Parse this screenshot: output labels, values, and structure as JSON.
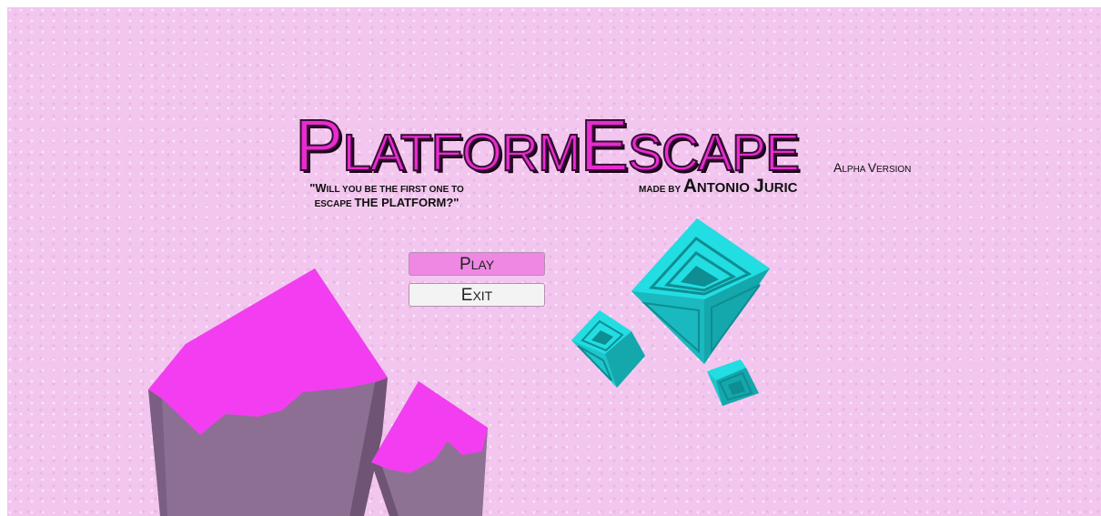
{
  "game": {
    "title_first": "P",
    "title_rest1": "LATFORM",
    "title_mid": "E",
    "title_rest2": "SCAPE",
    "version_first": "A",
    "version_rest1": "LPHA ",
    "version_v": "V",
    "version_rest2": "ERSION",
    "tagline_line1_big": "\"W",
    "tagline_line1_small": "ILL YOU BE THE FIRST ONE TO",
    "tagline_line2_small": "ESCAPE ",
    "tagline_line2_big": "THE PLATFORM?\"",
    "credit_prefix": "MADE BY ",
    "credit_a": "A",
    "credit_ntonio": "NTONIO ",
    "credit_j": "J",
    "credit_uric": "URIC"
  },
  "menu": {
    "play_first": "P",
    "play_rest": "LAY",
    "exit_first": "E",
    "exit_rest": "XIT"
  },
  "colors": {
    "background": "#f2c6ee",
    "title": "#e82ccf",
    "play_button": "#ee88e3",
    "exit_button": "#f3f3f3",
    "rock_top": "#f23ef0",
    "rock_side": "#8c6f92",
    "cube": "#1fd3d8"
  }
}
